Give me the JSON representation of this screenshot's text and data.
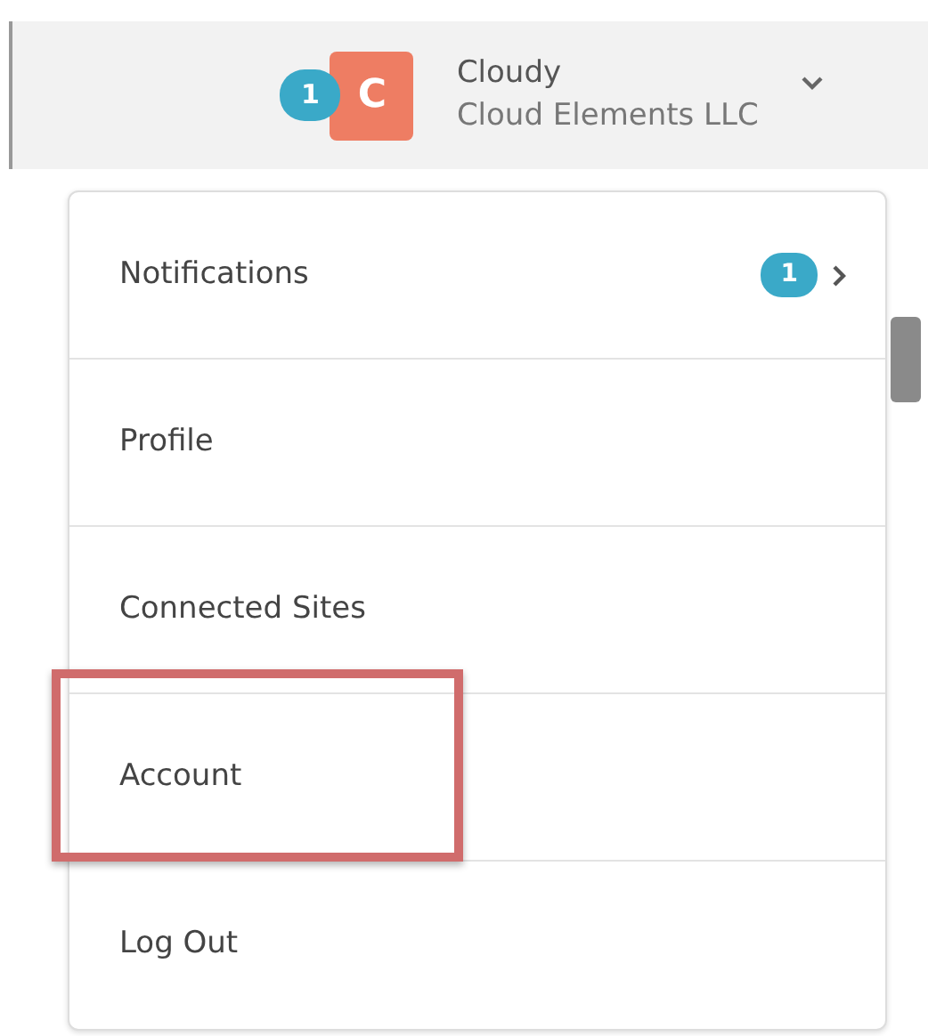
{
  "header": {
    "notification_count": "1",
    "avatar_letter": "C",
    "user_name": "Cloudy",
    "company": "Cloud Elements LLC"
  },
  "menu": [
    {
      "label": "Notifications",
      "badge": "1",
      "has_submenu": true,
      "highlighted": false
    },
    {
      "label": "Profile",
      "has_submenu": false,
      "highlighted": false
    },
    {
      "label": "Connected Sites",
      "has_submenu": false,
      "highlighted": false
    },
    {
      "label": "Account",
      "has_submenu": false,
      "highlighted": true
    },
    {
      "label": "Log Out",
      "has_submenu": false,
      "highlighted": false
    }
  ]
}
